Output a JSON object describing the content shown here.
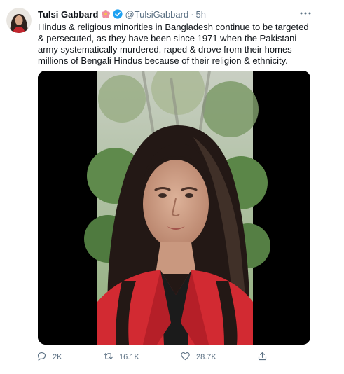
{
  "tweet": {
    "author_name": "Tulsi Gabbard",
    "handle": "@TulsiGabbard",
    "separator": "·",
    "time": "5h",
    "text": "Hindus & religious minorities in Bangladesh continue to be targeted & persecuted, as they have been since 1971 when the Pakistani army systematically murdered, raped & drove from their homes millions of Bengali Hindus because of their religion & ethnicity.",
    "media": {
      "type": "video"
    }
  },
  "actions": {
    "reply_count": "2K",
    "retweet_count": "16.1K",
    "like_count": "28.7K"
  },
  "colors": {
    "text_primary": "#0f1419",
    "text_secondary": "#5b7083",
    "verified_blue": "#1da1f2",
    "media_background": "#000000",
    "border": "#e6ecf0"
  },
  "icons": [
    "flower-emoji-icon",
    "verified-badge-icon",
    "more-options-icon",
    "reply-icon",
    "retweet-icon",
    "like-icon",
    "share-icon"
  ]
}
